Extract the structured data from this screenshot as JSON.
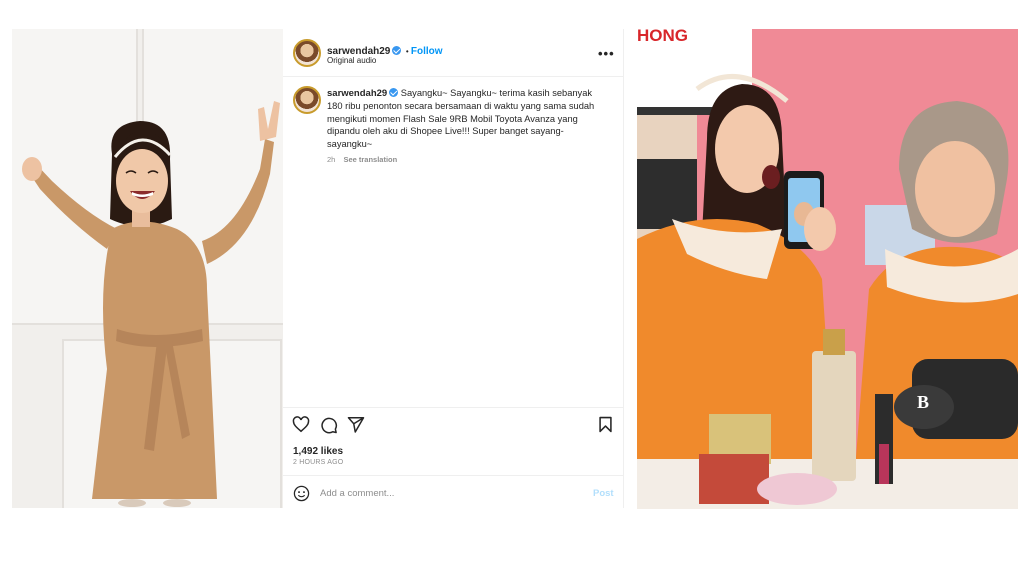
{
  "post": {
    "username": "sarwendah29",
    "follow_label": "Follow",
    "audio": "Original audio",
    "caption": "Sayangku~ Sayangku~ terima kasih sebanyak 180 ribu penonton secara bersamaan di waktu yang sama sudah mengikuti momen Flash Sale 9RB Mobil Toyota Avanza yang dipandu oleh aku di Shopee Live!!! Super banget sayang-sayangku~",
    "caption_lines": [
      "Sayangku~ Sayangku~ terima kasih sebanyak",
      "180 ribu penonton secara bersamaan di waktu yang sama sudah",
      "mengikuti momen Flash Sale 9RB Mobil Toyota Avanza yang",
      "dipandu oleh aku di Shopee Live!!! Super banget sayang-",
      "sayangku~"
    ],
    "time_short": "2h",
    "see_translation": "See translation",
    "likes": "1,492 likes",
    "time_ago": "2 HOURS AGO",
    "comment_placeholder": "Add a comment...",
    "post_label": "Post"
  },
  "right_image": {
    "sign_text": "HONG",
    "product_label_1": "B"
  },
  "icons": {
    "more": "more-options-icon",
    "like": "heart-icon",
    "comment": "comment-icon",
    "share": "send-icon",
    "save": "bookmark-icon",
    "emoji": "emoji-icon",
    "mute": "muted-speaker-icon"
  },
  "colors": {
    "link_blue": "#0095f6",
    "verified_blue": "#3897f0",
    "muted_text": "#8e8e8e",
    "post_disabled": "#b2dffc",
    "dress_left": "#c99868",
    "dress_right": "#f08a2c",
    "background_pink": "#f08a96"
  }
}
